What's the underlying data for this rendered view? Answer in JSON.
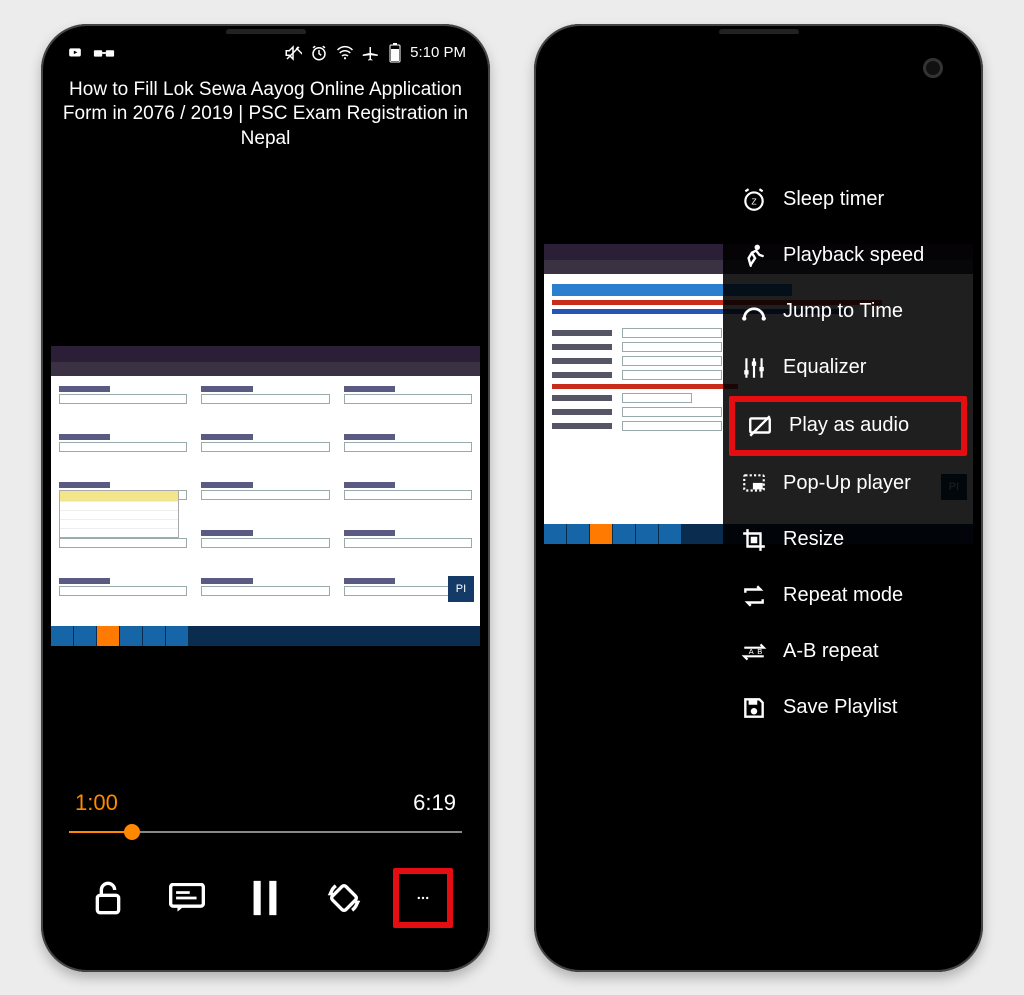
{
  "status_bar": {
    "time": "5:10 PM"
  },
  "video": {
    "title": "How to Fill Lok Sewa Aayog Online Application Form in 2076 / 2019 | PSC Exam Registration in Nepal",
    "logo": "PI"
  },
  "player": {
    "current_time": "1:00",
    "duration": "6:19",
    "progress_percent": 16,
    "controls": {
      "lock": "lock-open-icon",
      "subtitles": "subtitles-icon",
      "playpause": "pause-icon",
      "rotate": "rotate-icon",
      "more": "more-icon"
    }
  },
  "menu": {
    "items": [
      {
        "id": "sleep-timer",
        "label": "Sleep timer",
        "icon": "alarm-snooze-icon"
      },
      {
        "id": "playback-speed",
        "label": "Playback speed",
        "icon": "running-icon"
      },
      {
        "id": "jump-to-time",
        "label": "Jump to Time",
        "icon": "jump-arc-icon"
      },
      {
        "id": "equalizer",
        "label": "Equalizer",
        "icon": "equalizer-icon"
      },
      {
        "id": "play-as-audio",
        "label": "Play as audio",
        "icon": "monitor-off-icon",
        "highlight": true
      },
      {
        "id": "popup-player",
        "label": "Pop-Up player",
        "icon": "pip-icon"
      },
      {
        "id": "resize",
        "label": "Resize",
        "icon": "resize-crop-icon"
      },
      {
        "id": "repeat-mode",
        "label": "Repeat mode",
        "icon": "repeat-icon"
      },
      {
        "id": "ab-repeat",
        "label": "A-B repeat",
        "icon": "ab-repeat-icon"
      },
      {
        "id": "save-playlist",
        "label": "Save Playlist",
        "icon": "save-icon"
      }
    ]
  }
}
